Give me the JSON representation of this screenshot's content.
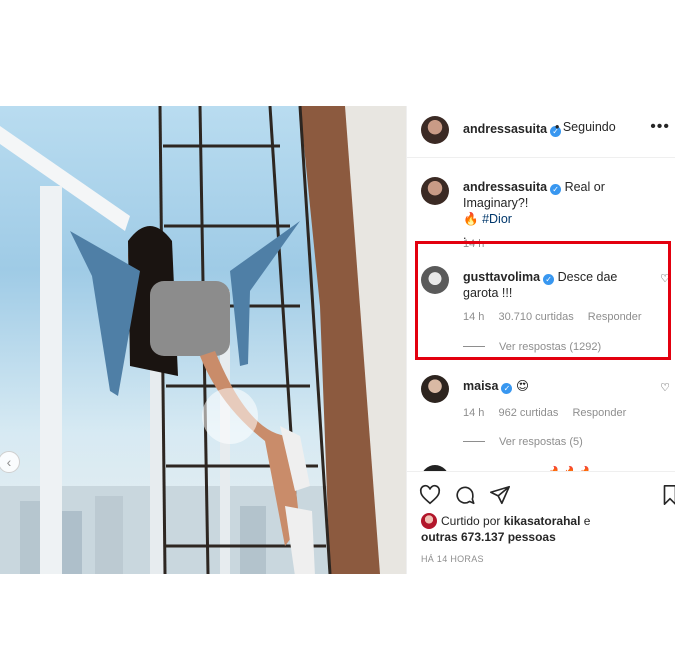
{
  "post": {
    "author": "andressasuita",
    "follow_status": "• Seguindo",
    "more": "•••"
  },
  "comments": [
    {
      "user": "andressasuita",
      "text": "Real or Imaginary?!",
      "line2_emoji": "🔥",
      "tag": "#Dior",
      "line3": ".",
      "time": "14 h"
    },
    {
      "user": "gusttavolima",
      "text": "Desce dae garota !!!",
      "time": "14 h",
      "likes": "30.710 curtidas",
      "reply": "Responder",
      "view_replies": "Ver respostas (1292)"
    },
    {
      "user": "maisa",
      "text": "😍",
      "time": "14 h",
      "likes": "962 curtidas",
      "reply": "Responder",
      "view_replies": "Ver respostas (5)"
    },
    {
      "partial_text": "🔥🔥🔥"
    }
  ],
  "likes": {
    "prefix": "Curtido por",
    "user": "kikasatorahal",
    "connector": "e",
    "others": "outras 673.137 pessoas"
  },
  "posted_ago": "HÁ 14 HORAS",
  "icons": {
    "like": "heart-icon",
    "comment": "comment-icon",
    "share": "send-icon",
    "save": "bookmark-icon",
    "prev": "chevron-left-icon",
    "verified": "verified-badge-icon"
  },
  "colors": {
    "highlight": "#e3000f",
    "verified": "#3897f0",
    "link": "#00376b",
    "muted": "#8e8e8e"
  }
}
